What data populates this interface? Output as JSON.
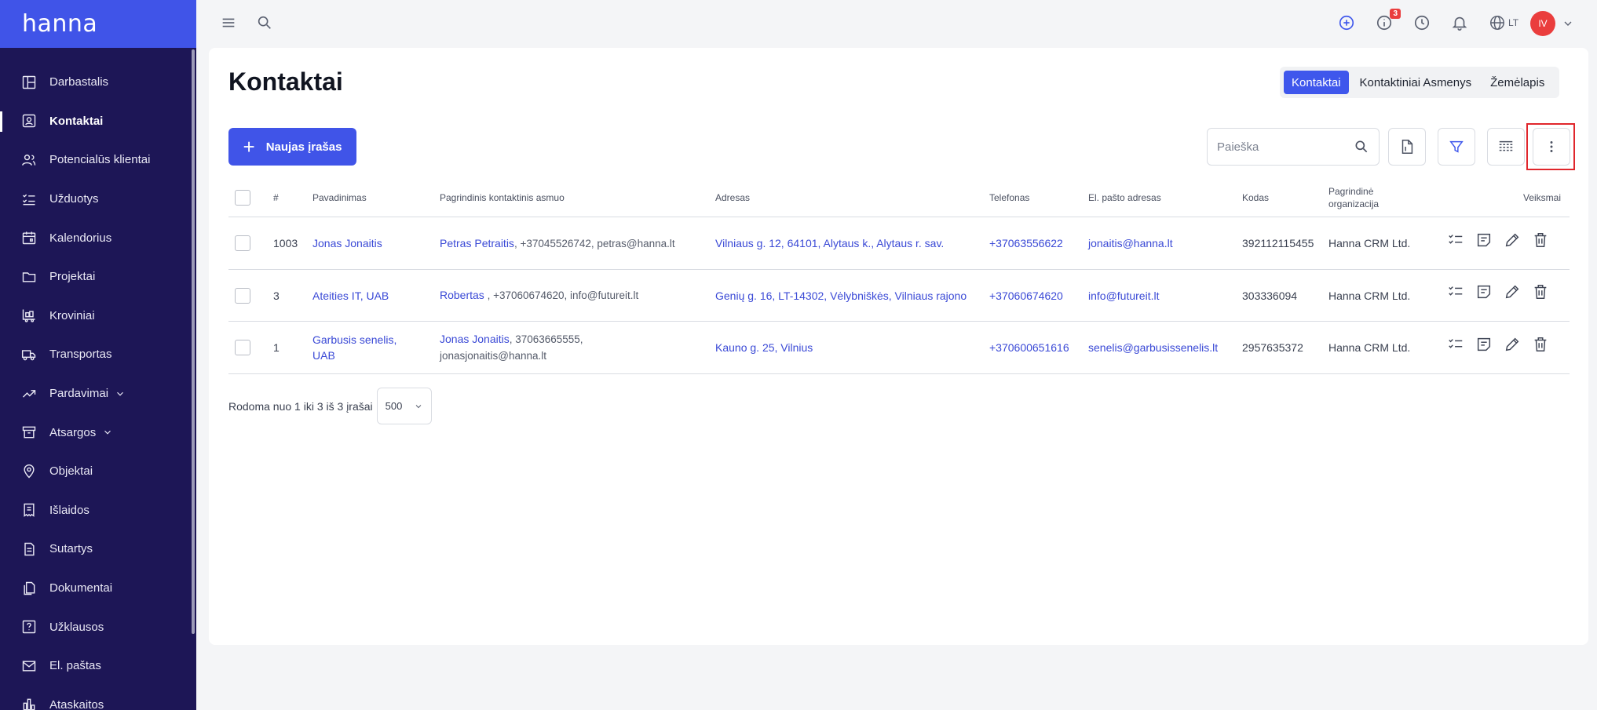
{
  "app": {
    "logo": "hanna"
  },
  "sidebar": {
    "items": [
      {
        "label": "Darbastalis",
        "icon": "dashboard-icon"
      },
      {
        "label": "Kontaktai",
        "icon": "contact-card-icon",
        "active": true
      },
      {
        "label": "Potencialūs klientai",
        "icon": "users-icon"
      },
      {
        "label": "Užduotys",
        "icon": "checklist-icon"
      },
      {
        "label": "Kalendorius",
        "icon": "calendar-icon"
      },
      {
        "label": "Projektai",
        "icon": "folder-icon"
      },
      {
        "label": "Kroviniai",
        "icon": "cart-icon"
      },
      {
        "label": "Transportas",
        "icon": "truck-icon"
      },
      {
        "label": "Pardavimai",
        "icon": "trend-icon",
        "expandable": true
      },
      {
        "label": "Atsargos",
        "icon": "archive-icon",
        "expandable": true
      },
      {
        "label": "Objektai",
        "icon": "map-pin-icon"
      },
      {
        "label": "Išlaidos",
        "icon": "receipt-icon"
      },
      {
        "label": "Sutartys",
        "icon": "document-icon"
      },
      {
        "label": "Dokumentai",
        "icon": "documents-icon"
      },
      {
        "label": "Užklausos",
        "icon": "question-icon"
      },
      {
        "label": "El. paštas",
        "icon": "mail-icon"
      },
      {
        "label": "Ataskaitos",
        "icon": "bar-chart-icon"
      }
    ]
  },
  "topbar": {
    "notification_badge": "3",
    "language": "LT",
    "avatar_initials": "IV"
  },
  "page": {
    "title": "Kontaktai",
    "tabs": [
      {
        "label": "Kontaktai",
        "active": true
      },
      {
        "label": "Kontaktiniai Asmenys",
        "active": false
      },
      {
        "label": "Žemėlapis",
        "active": false
      }
    ],
    "new_button": "Naujas įrašas",
    "search_placeholder": "Paieška"
  },
  "table": {
    "headers": {
      "num": "#",
      "name": "Pavadinimas",
      "contact": "Pagrindinis kontaktinis asmuo",
      "address": "Adresas",
      "phone": "Telefonas",
      "email": "El. pašto adresas",
      "code": "Kodas",
      "org": "Pagrindinė organizacija",
      "actions": "Veiksmai"
    },
    "rows": [
      {
        "num": "1003",
        "name": "Jonas Jonaitis",
        "contact_name": "Petras Petraitis",
        "contact_details": ", +37045526742, petras@hanna.lt",
        "address": "Vilniaus g. 12, 64101, Alytaus k., Alytaus r. sav.",
        "phone": "+37063556622",
        "email": "jonaitis@hanna.lt",
        "code": "392112115455",
        "org": "Hanna CRM Ltd."
      },
      {
        "num": "3",
        "name": "Ateities IT, UAB",
        "contact_name": "Robertas",
        "contact_details": " , +37060674620, info@futureit.lt",
        "address": "Genių g. 16, LT-14302, Vėlybniškės, Vilniaus rajono",
        "phone": "+37060674620",
        "email": "info@futureit.lt",
        "code": "303336094",
        "org": "Hanna CRM Ltd."
      },
      {
        "num": "1",
        "name": "Garbusis senelis, UAB",
        "contact_name": "Jonas Jonaitis",
        "contact_details": ", 37063665555, jonasjonaitis@hanna.lt",
        "address": "Kauno g. 25, Vilnius",
        "phone": "+370600651616",
        "email": "senelis@garbusissenelis.lt",
        "code": "2957635372",
        "org": "Hanna CRM Ltd."
      }
    ]
  },
  "pager": {
    "summary": "Rodoma nuo 1 iki 3 iš 3 įrašai",
    "page_size": "500"
  }
}
